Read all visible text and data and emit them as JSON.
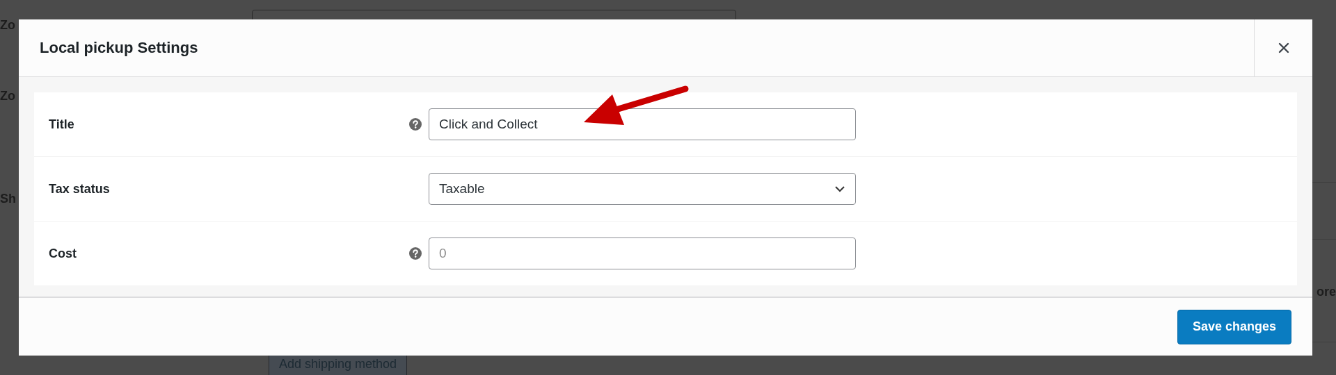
{
  "background": {
    "texts": [
      "Zo",
      "Zo",
      "Sh",
      "ore"
    ],
    "button": "Add shipping method"
  },
  "modal": {
    "title": "Local pickup Settings",
    "fields": [
      {
        "label": "Title",
        "kind": "text",
        "help": true,
        "value": "Click and Collect"
      },
      {
        "label": "Tax status",
        "kind": "select",
        "help": false,
        "value": "Taxable"
      },
      {
        "label": "Cost",
        "kind": "text",
        "help": true,
        "placeholder": "0"
      }
    ],
    "save_button": "Save changes"
  }
}
